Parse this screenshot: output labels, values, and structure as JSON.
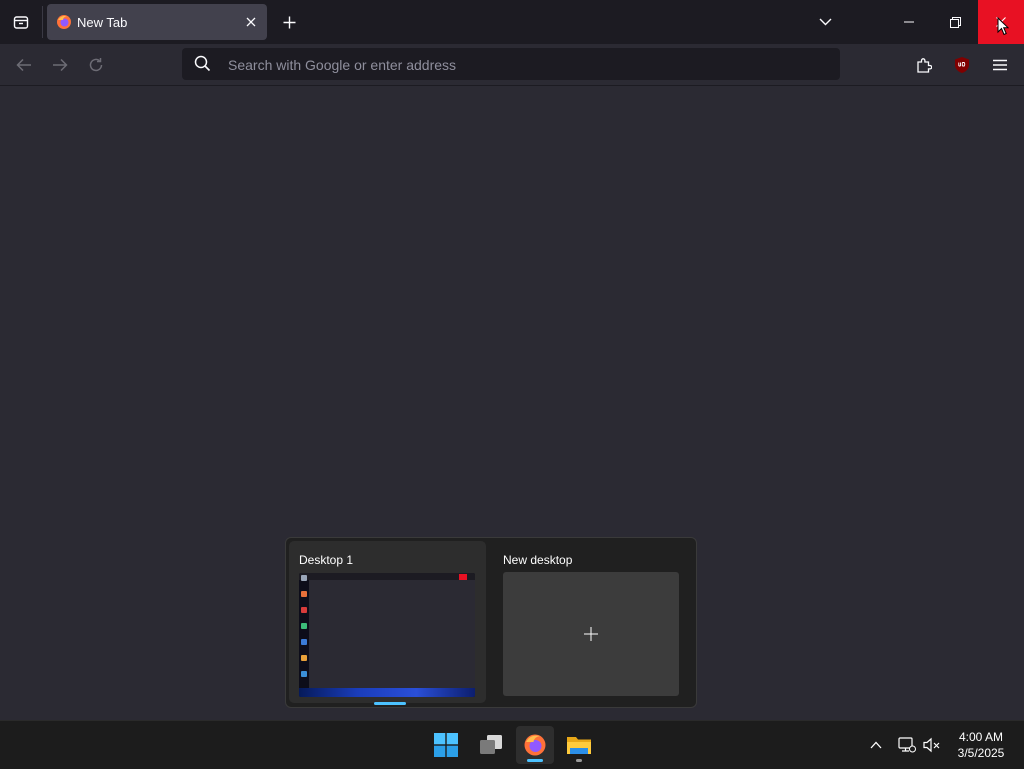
{
  "browser": {
    "tab": {
      "title": "New Tab"
    },
    "urlbar": {
      "placeholder": "Search with Google or enter address"
    },
    "close_button_color": "#e81123"
  },
  "task_view": {
    "desktops": [
      {
        "label": "Desktop 1"
      },
      {
        "label": "New desktop"
      }
    ]
  },
  "taskbar": {
    "apps": [
      "start-icon",
      "task-view-icon",
      "firefox-icon",
      "file-explorer-icon"
    ],
    "clock": {
      "time": "4:00 AM",
      "date": "3/5/2025"
    }
  }
}
